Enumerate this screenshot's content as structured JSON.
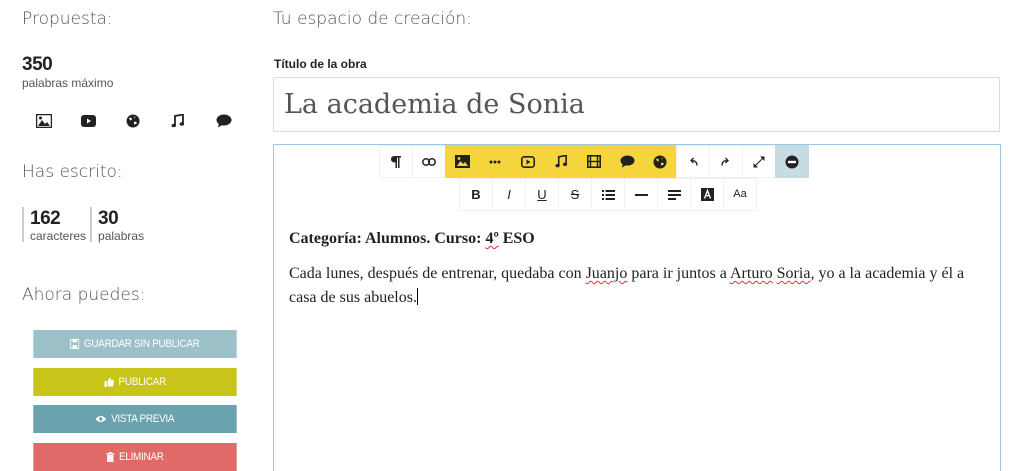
{
  "sidebar": {
    "proposal_heading": "Propuesta:",
    "max_words_value": "350",
    "max_words_label": "palabras máximo",
    "media_icons": [
      "image-icon",
      "video-icon",
      "globe-icon",
      "music-icon",
      "speech-bubble-icon"
    ],
    "written_heading": "Has escrito:",
    "stats": {
      "characters_value": "162",
      "characters_label": "caracteres",
      "words_value": "30",
      "words_label": "palabras"
    },
    "actions_heading": "Ahora puedes:",
    "buttons": {
      "save_label": "GUARDAR SIN PUBLICAR",
      "publish_label": "PUBLICAR",
      "preview_label": "VISTA PREVIA",
      "delete_label": "ELIMINAR"
    }
  },
  "main": {
    "heading": "Tu espacio de creación:",
    "title_label": "Título de la obra",
    "title_value": "La academia de Sonia"
  },
  "toolbar": {
    "font_size_label": "Aa",
    "bold_label": "B",
    "italic_label": "I",
    "underline_label": "U",
    "strike_label": "S"
  },
  "editor": {
    "category_prefix": "Categoría: Alumnos. Curso: ",
    "category_course": "4º",
    "category_suffix": " ESO",
    "para_1": "Cada lunes, después de entrenar, quedaba con ",
    "name_1": "Juanjo",
    "para_2": " para ir juntos a ",
    "name_2": "Arturo",
    "para_3": " ",
    "name_3": "Soria",
    "para_4": ", yo a la academia y él a casa de sus abuelos."
  },
  "colors": {
    "save": "#9dc1c9",
    "publish": "#c8c419",
    "preview": "#6aa2ad",
    "delete": "#e06a68",
    "toolbar_highlight": "#f4d63c",
    "toolbar_active": "#c7dbe3",
    "editor_border": "#9cc6e6"
  }
}
